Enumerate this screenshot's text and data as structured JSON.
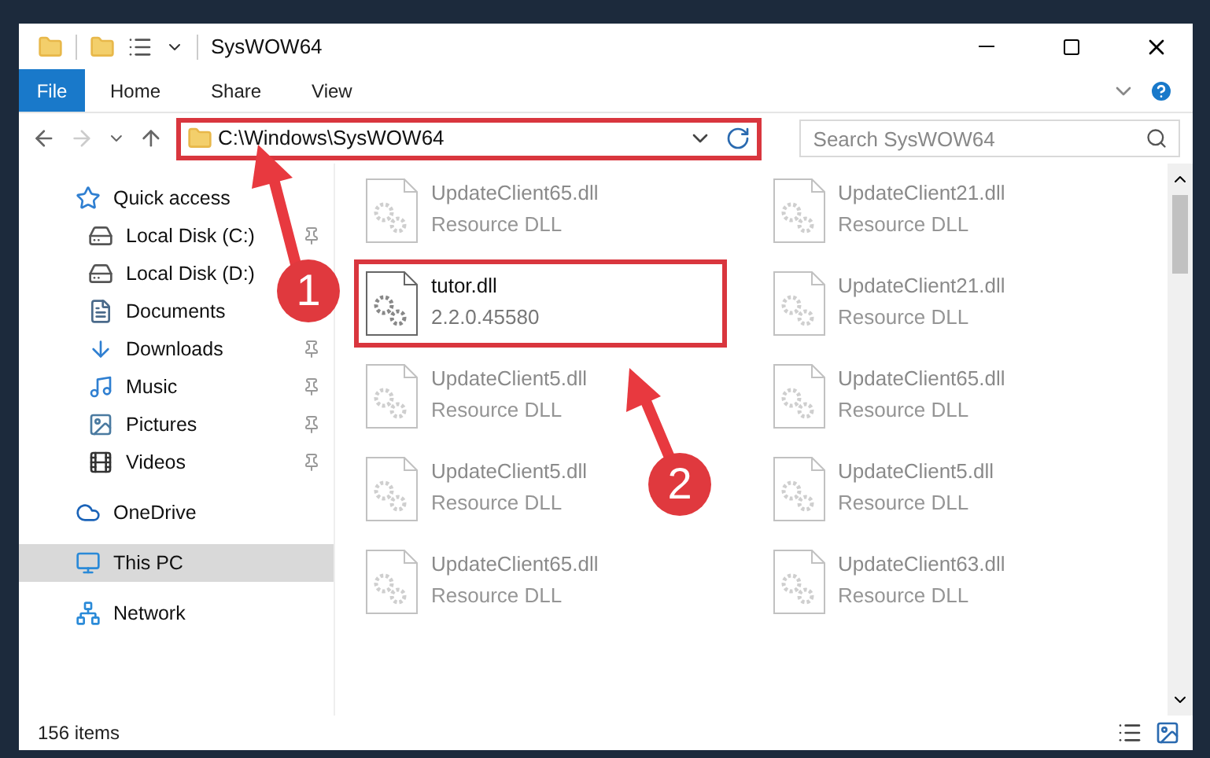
{
  "window": {
    "title": "SysWOW64"
  },
  "ribbon_tabs": [
    {
      "label": "File",
      "selected": true
    },
    {
      "label": "Home",
      "selected": false
    },
    {
      "label": "Share",
      "selected": false
    },
    {
      "label": "View",
      "selected": false
    }
  ],
  "address": {
    "path": "C:\\Windows\\SysWOW64",
    "highlighted": true
  },
  "search": {
    "placeholder": "Search SysWOW64"
  },
  "sidebar": {
    "items": [
      {
        "label": "Quick access",
        "kind": "star",
        "pinned": false,
        "selected": false,
        "children": [
          {
            "label": "Local Disk (C:)",
            "kind": "drive",
            "pinned": true,
            "selected": false
          },
          {
            "label": "Local Disk (D:)",
            "kind": "drive",
            "pinned": false,
            "selected": false
          },
          {
            "label": "Documents",
            "kind": "document",
            "pinned": false,
            "selected": false
          },
          {
            "label": "Downloads",
            "kind": "download",
            "pinned": true,
            "selected": false
          },
          {
            "label": "Music",
            "kind": "music",
            "pinned": true,
            "selected": false
          },
          {
            "label": "Pictures",
            "kind": "pictures",
            "pinned": true,
            "selected": false
          },
          {
            "label": "Videos",
            "kind": "video",
            "pinned": true,
            "selected": false
          }
        ]
      },
      {
        "label": "OneDrive",
        "kind": "cloud",
        "pinned": false,
        "selected": false
      },
      {
        "label": "This PC",
        "kind": "pc",
        "pinned": false,
        "selected": true
      },
      {
        "label": "Network",
        "kind": "network",
        "pinned": false,
        "selected": false
      }
    ]
  },
  "files": [
    {
      "name": "UpdateClient65.dll",
      "detail": "Resource DLL",
      "dimmed": true,
      "highlighted": false
    },
    {
      "name": "UpdateClient21.dll",
      "detail": "Resource DLL",
      "dimmed": true,
      "highlighted": false
    },
    {
      "name": "tutor.dll",
      "detail": "2.2.0.45580",
      "dimmed": false,
      "highlighted": true
    },
    {
      "name": "UpdateClient21.dll",
      "detail": "Resource DLL",
      "dimmed": true,
      "highlighted": false
    },
    {
      "name": "UpdateClient5.dll",
      "detail": "Resource DLL",
      "dimmed": true,
      "highlighted": false
    },
    {
      "name": "UpdateClient65.dll",
      "detail": "Resource DLL",
      "dimmed": true,
      "highlighted": false
    },
    {
      "name": "UpdateClient5.dll",
      "detail": "Resource DLL",
      "dimmed": true,
      "highlighted": false
    },
    {
      "name": "UpdateClient5.dll",
      "detail": "Resource DLL",
      "dimmed": true,
      "highlighted": false
    },
    {
      "name": "UpdateClient65.dll",
      "detail": "Resource DLL",
      "dimmed": true,
      "highlighted": false
    },
    {
      "name": "UpdateClient63.dll",
      "detail": "Resource DLL",
      "dimmed": true,
      "highlighted": false
    }
  ],
  "status_bar": {
    "item_count": "156 items"
  },
  "annotations": [
    {
      "number": "1"
    },
    {
      "number": "2"
    }
  ]
}
